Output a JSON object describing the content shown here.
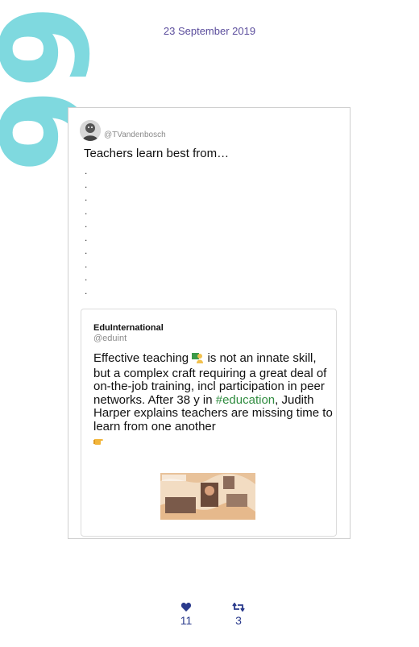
{
  "header": {
    "quote_glyph": "66",
    "date": "23 September 2019"
  },
  "tweet": {
    "handle": "@TVandenbosch",
    "text": "Teachers learn best from…",
    "dot": "."
  },
  "quoted": {
    "name": "EduInternational",
    "handle": "@eduint",
    "text_before_emoji": "Effective teaching ",
    "text_after_emoji": " is not an innate skill, but a complex craft requiring a great deal of on-the-job training, incl participation in peer networks. After 38 y in ",
    "hashtag": "#education",
    "text_after_hashtag": ", Judith Harper explains teachers are missing time to learn from one another"
  },
  "stats": {
    "likes": "11",
    "retweets": "3"
  },
  "icons": {
    "quote": "quote-icon",
    "like": "heart-icon",
    "retweet": "retweet-icon",
    "teacher": "teacher-emoji-icon",
    "pointing": "pointing-hand-icon"
  },
  "colors": {
    "quote_mark": "#7fd9df",
    "date": "#5a4c9c",
    "hashtag": "#2e8b3e",
    "stats": "#2a3a8c"
  }
}
